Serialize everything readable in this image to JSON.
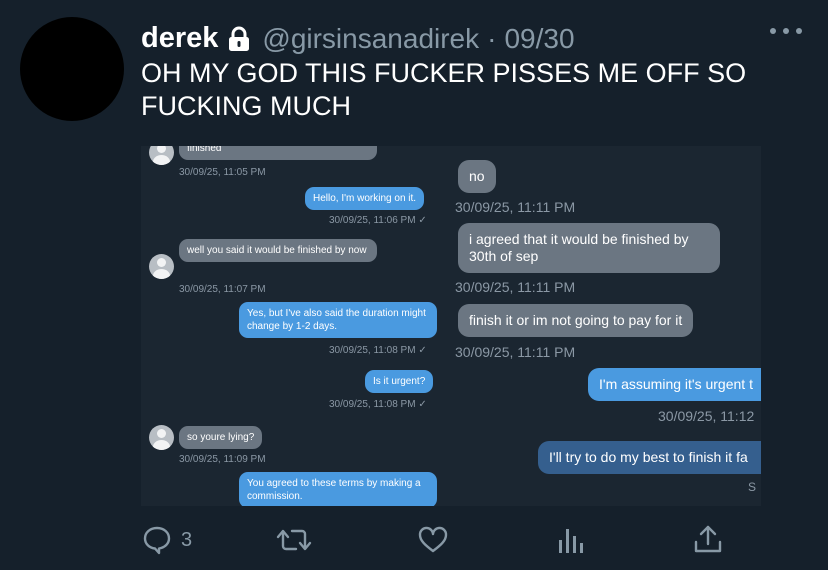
{
  "tweet": {
    "display_name": "derek",
    "handle": "@girsinsanadirek",
    "separator": "·",
    "date": "09/30",
    "text": "OH MY GOD THIS FUCKER PISSES ME OFF SO FUCKING MUCH"
  },
  "left_chat": {
    "messages": [
      {
        "dir": "in",
        "text": "finished",
        "time": "30/09/25, 11:05 PM"
      },
      {
        "dir": "out",
        "text": "Hello, I'm working on it.",
        "time": "30/09/25, 11:06 PM ✓"
      },
      {
        "dir": "in",
        "text": "well you said it would be finished by now",
        "time": "30/09/25, 11:07 PM"
      },
      {
        "dir": "out",
        "text": "Yes, but I've also said the duration might change by 1-2 days.",
        "time": "30/09/25, 11:08 PM ✓"
      },
      {
        "dir": "out",
        "text": "Is it urgent?",
        "time": "30/09/25, 11:08 PM ✓"
      },
      {
        "dir": "in",
        "text": "so youre lying?",
        "time": "30/09/25, 11:09 PM"
      },
      {
        "dir": "out",
        "text": "You agreed to these terms by making a commission.",
        "time": ""
      }
    ]
  },
  "right_chat": {
    "messages": [
      {
        "dir": "in",
        "text": "no",
        "time": "30/09/25, 11:11 PM"
      },
      {
        "dir": "in",
        "text": "i agreed that it would be finished by 30th of sep",
        "time": "30/09/25, 11:11 PM"
      },
      {
        "dir": "in",
        "text": "finish it or im not going to pay for it",
        "time": "30/09/25, 11:11 PM"
      },
      {
        "dir": "out",
        "text": "I'm assuming it's urgent t",
        "time": "30/09/25, 11:12"
      },
      {
        "dir": "out",
        "text": "I'll try to do my best to finish it fa",
        "time": "S"
      }
    ]
  },
  "actions": {
    "reply_count": "3",
    "icons": [
      "reply-icon",
      "retweet-icon",
      "like-icon",
      "analytics-icon",
      "share-icon"
    ]
  },
  "colors": {
    "background": "#15202b",
    "secondary_text": "#8899a6",
    "bubble_in": "#6b7682",
    "bubble_out": "#4a9ae0"
  }
}
